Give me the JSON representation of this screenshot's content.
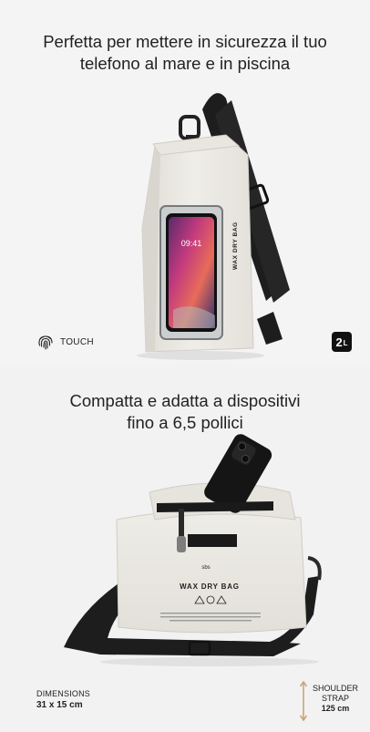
{
  "section_top": {
    "headline_line1": "Perfetta per mettere in sicurezza il tuo",
    "headline_line2": "telefono al mare e in piscina",
    "phone_time": "09:41",
    "bag_print": "WAX DRY BAG",
    "touch_label": "TOUCH",
    "touch_icon": "fingerprint-icon",
    "capacity_value": "2",
    "capacity_unit": "L"
  },
  "section_bottom": {
    "headline_line1": "Compatta e adatta a dispositivi",
    "headline_line2": "fino a 6,5 pollici",
    "bag_brand": "sbs",
    "bag_print": "WAX DRY BAG",
    "dimensions_label": "DIMENSIONS",
    "dimensions_value": "31 x 15 cm",
    "strap_label_line1": "SHOULDER",
    "strap_label_line2": "STRAP",
    "strap_value": "125 cm",
    "strap_icon": "double-arrow-vertical-icon"
  },
  "colors": {
    "background": "#f3f3f3",
    "bag_body": "#ebe9e3",
    "strap": "#1d1d1d",
    "arrow_accent": "#c9a57a"
  }
}
